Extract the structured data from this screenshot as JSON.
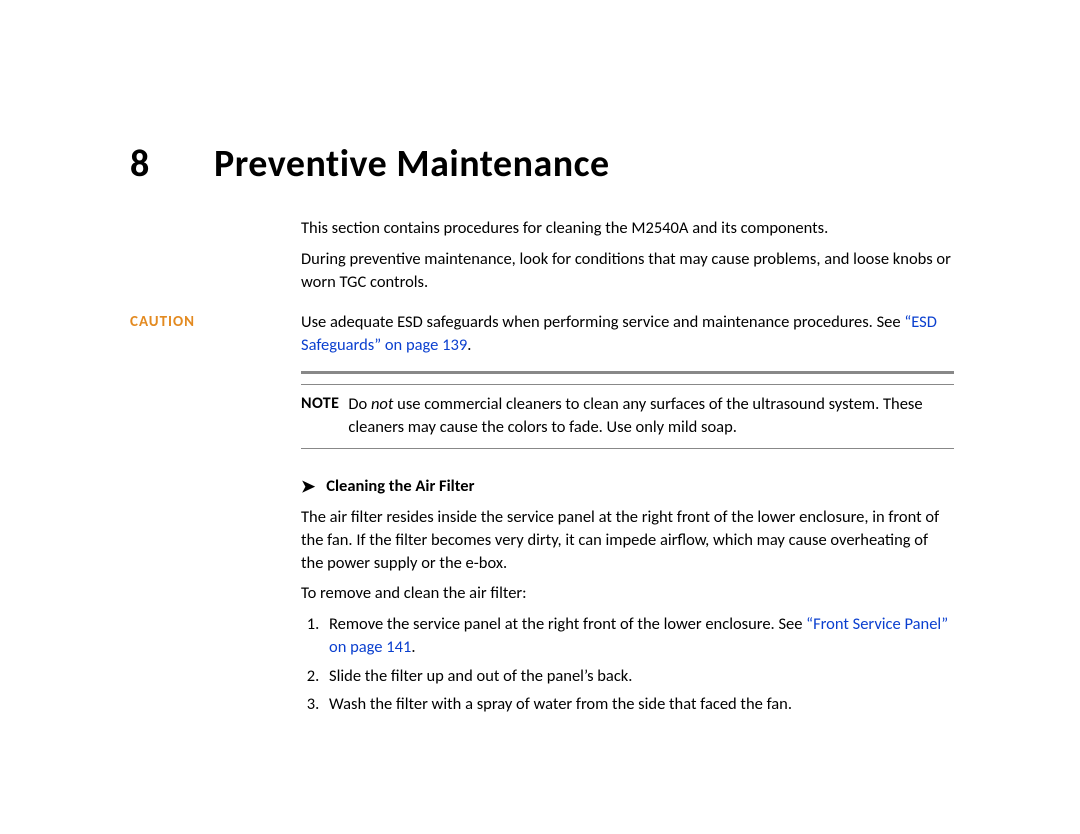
{
  "chapter": {
    "number": "8",
    "title": "Preventive Maintenance"
  },
  "intro": {
    "p1": "This section contains procedures for cleaning the M2540A and its components.",
    "p2": "During preventive maintenance, look for conditions that may cause problems, and loose knobs or worn TGC controls."
  },
  "caution": {
    "label": "CAUTION",
    "text_before_link": "Use adequate ESD safeguards when performing service and maintenance procedures. See ",
    "link_text": "“ESD Safeguards” on page 139",
    "text_after_link": "."
  },
  "note": {
    "label": "NOTE",
    "pre": "Do ",
    "em": "not",
    "post": " use commercial cleaners to clean any surfaces of the ultrasound system. These cleaners may cause the colors to fade. Use only mild soap."
  },
  "procedure": {
    "arrow": "➤",
    "title": "Cleaning the Air Filter",
    "p1": "The air filter resides inside the service panel at the right front of the lower enclosure, in front of the fan. If the filter becomes very dirty, it can impede airflow, which may cause overheating of the power supply or the e-box.",
    "p2": "To remove and clean the air filter:",
    "steps": {
      "s1_pre": "Remove the service panel at the right front of the lower enclosure. See ",
      "s1_link": "“Front Service Panel” on page 141",
      "s1_post": ".",
      "s2": "Slide the filter up and out of the panel’s back.",
      "s3": "Wash the filter with a spray of water from the side that faced the fan."
    }
  }
}
